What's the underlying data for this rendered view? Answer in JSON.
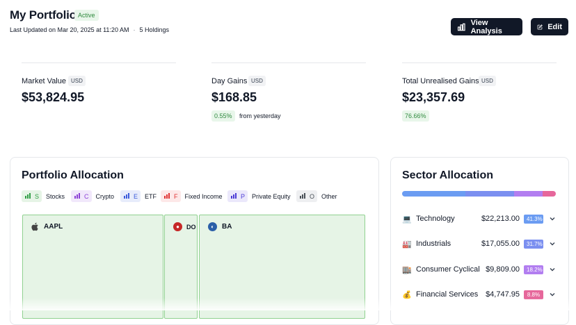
{
  "header": {
    "title": "My Portfolio",
    "status": "Active",
    "last_updated": "Last Updated on Mar 20, 2025 at 11:20 AM",
    "separator": "·",
    "holdings": "5 Holdings",
    "view_analysis": "View Analysis",
    "edit": "Edit"
  },
  "metrics": [
    {
      "label": "Market Value",
      "currency": "USD",
      "value": "$53,824.95"
    },
    {
      "label": "Day Gains",
      "currency": "USD",
      "value": "$168.85",
      "change": "0.55%",
      "note": "from yesterday"
    },
    {
      "label": "Total Unrealised Gains",
      "currency": "USD",
      "value": "$23,357.69",
      "change": "76.66%"
    }
  ],
  "portfolio_allocation": {
    "title": "Portfolio Allocation",
    "legend": [
      {
        "letter": "S",
        "label": "Stocks",
        "color": "#2f9e44",
        "bg": "#e6f4e6"
      },
      {
        "letter": "C",
        "label": "Crypto",
        "color": "#8b3fd6",
        "bg": "#f1e8fb"
      },
      {
        "letter": "E",
        "label": "ETF",
        "color": "#3b5bdb",
        "bg": "#e7ecfb"
      },
      {
        "letter": "F",
        "label": "Fixed Income",
        "color": "#e03131",
        "bg": "#fde8e8"
      },
      {
        "letter": "P",
        "label": "Private Equity",
        "color": "#4c3bd6",
        "bg": "#ebe8fb"
      },
      {
        "letter": "O",
        "label": "Other",
        "color": "#495057",
        "bg": "#eeeff1"
      }
    ],
    "tiles": [
      {
        "ticker": "AAPL",
        "icon": "apple-icon"
      },
      {
        "ticker": "DO",
        "icon": "doordash-icon"
      },
      {
        "ticker": "BA",
        "icon": "boeing-icon"
      }
    ]
  },
  "sector_allocation": {
    "title": "Sector Allocation",
    "bar_colors": [
      "#6b9cf2",
      "#7b8ff0",
      "#b27ef0",
      "#e6679b"
    ],
    "rows": [
      {
        "name": "Technology",
        "amount": "$22,213.00",
        "pct": "41.3%",
        "share": 41.3,
        "color": "#6b9cf2",
        "icon": "laptop-icon"
      },
      {
        "name": "Industrials",
        "amount": "$17,055.00",
        "pct": "31.7%",
        "share": 31.7,
        "color": "#7b8ff0",
        "icon": "factory-icon"
      },
      {
        "name": "Consumer Cyclical",
        "amount": "$9,809.00",
        "pct": "18.2%",
        "share": 18.2,
        "color": "#b27ef0",
        "icon": "store-icon"
      },
      {
        "name": "Financial Services",
        "amount": "$4,747.95",
        "pct": "8.8%",
        "share": 8.8,
        "color": "#e6679b",
        "icon": "money-bag-icon"
      }
    ]
  }
}
